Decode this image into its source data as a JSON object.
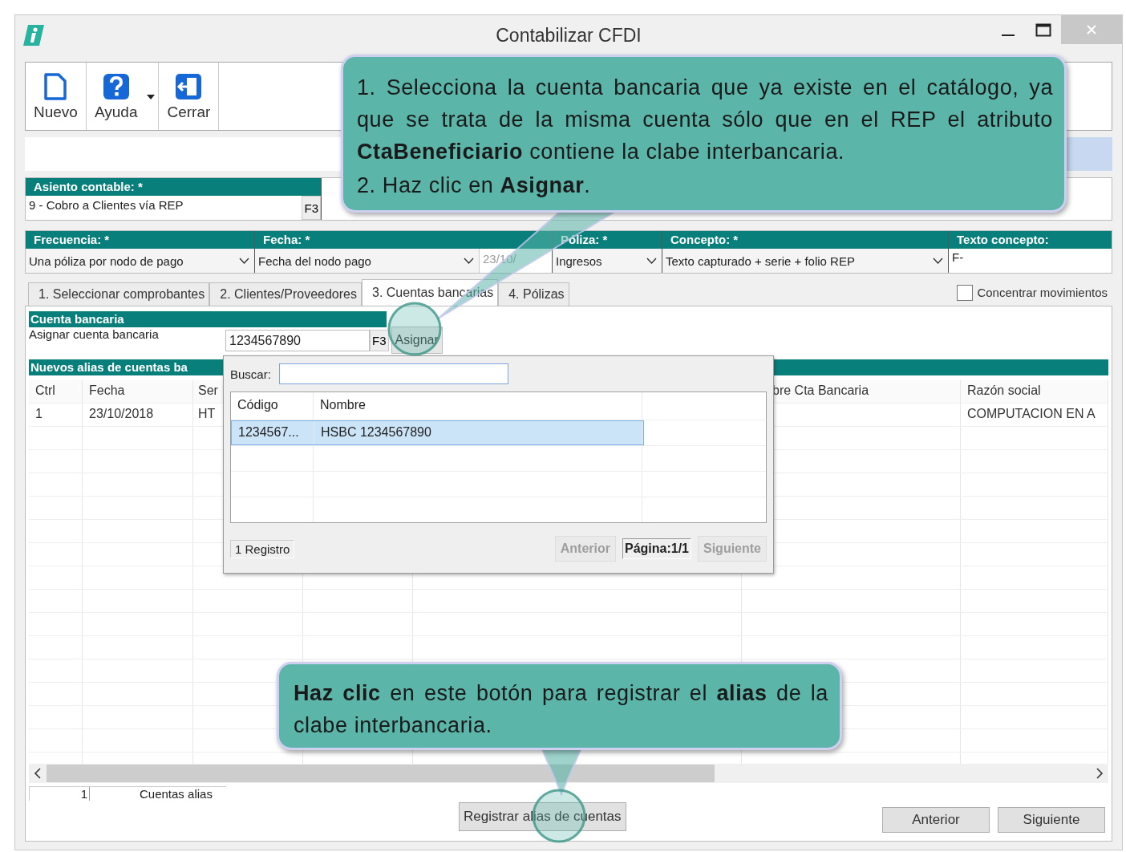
{
  "window": {
    "title": "Contabilizar CFDI"
  },
  "toolbar": [
    {
      "label": "Nuevo",
      "kind": "new",
      "dropdown": false
    },
    {
      "label": "Ayuda",
      "kind": "help",
      "dropdown": true
    },
    {
      "label": "Cerrar",
      "kind": "close",
      "dropdown": false
    }
  ],
  "accounting_entry": {
    "label": "Asiento contable: *",
    "value": "9 - Cobro a Clientes vía REP",
    "lookup": "F3"
  },
  "options": [
    {
      "label": "Frecuencia: *",
      "value": "Una póliza por nodo de pago",
      "kind": "select"
    },
    {
      "label": "Fecha: *",
      "value": "Fecha del nodo pago",
      "kind": "select",
      "date": "23/10/"
    },
    {
      "label": "Póliza: *",
      "value": "Ingresos",
      "kind": "select"
    },
    {
      "label": "Concepto: *",
      "value": "Texto capturado + serie + folio REP",
      "kind": "select"
    },
    {
      "label": "Texto concepto:",
      "value": "F-",
      "kind": "text"
    }
  ],
  "tabs": [
    {
      "label": "1. Seleccionar comprobantes",
      "selected": false
    },
    {
      "label": "2. Clientes/Proveedores",
      "selected": false
    },
    {
      "label": "3. Cuentas bancarias",
      "selected": true
    },
    {
      "label": "4. Pólizas",
      "selected": false
    }
  ],
  "concentrate": {
    "label": "Concentrar movimientos",
    "checked": false
  },
  "bank_account": {
    "title": "Cuenta bancaria",
    "label": "Asignar cuenta bancaria",
    "value": "1234567890",
    "lookup": "F3",
    "button": "Asignar"
  },
  "aliases": {
    "title": "Nuevos alias de cuentas ba",
    "columns": [
      "Ctrl",
      "Fecha",
      "Ser",
      "",
      "",
      "bre Cta Bancaria",
      "Razón social"
    ],
    "rows": [
      [
        "1",
        "23/10/2018",
        "HT",
        "",
        "",
        "",
        "COMPUTACION EN A"
      ]
    ],
    "count": "1",
    "count_label": "Cuentas alias",
    "register_button": "Registrar alias de cuentas"
  },
  "nav_buttons": [
    "Anterior",
    "Siguiente"
  ],
  "lookup_popup": {
    "search_label": "Buscar:",
    "columns": [
      "Código",
      "Nombre"
    ],
    "rows": [
      {
        "cells": [
          "1234567...",
          "HSBC 1234567890"
        ],
        "selected": true
      }
    ],
    "records": "1 Registro",
    "page": "Página:1/1",
    "buttons": [
      {
        "label": "Anterior",
        "disabled": true
      },
      {
        "label": "Siguiente",
        "disabled": true
      }
    ]
  },
  "callouts": [
    {
      "paragraphs": [
        "1. Selecciona la cuenta bancaria que ya existe en el catálogo, ya que se trata de la misma cuenta sólo que en el REP el atributo **CtaBeneficiario** contiene la clabe interbancaria.",
        "2. Haz clic en **Asignar**."
      ]
    },
    {
      "paragraphs": [
        "**Haz clic** en este botón para registrar el **alias** de la clabe interbancaria."
      ]
    }
  ]
}
